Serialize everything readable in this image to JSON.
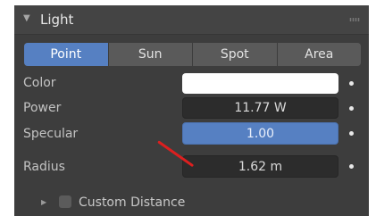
{
  "panel": {
    "title": "Light",
    "collapse_icon": "triangle-down-icon",
    "grip_icon": "drag-grip-icon"
  },
  "light_types": {
    "options": [
      "Point",
      "Sun",
      "Spot",
      "Area"
    ],
    "selected": "Point"
  },
  "properties": {
    "color": {
      "label": "Color",
      "value": "#ffffff"
    },
    "power": {
      "label": "Power",
      "value": "11.77 W"
    },
    "specular": {
      "label": "Specular",
      "value": "1.00"
    },
    "radius": {
      "label": "Radius",
      "value": "1.62 m"
    }
  },
  "subpanel": {
    "label": "Custom Distance",
    "checked": false
  },
  "annotation": {
    "color": "#dd1f1f"
  },
  "colors": {
    "panel_bg": "#3d3d3d",
    "header_bg": "#444444",
    "accent": "#5680c2",
    "field_bg": "#2c2c2c"
  }
}
